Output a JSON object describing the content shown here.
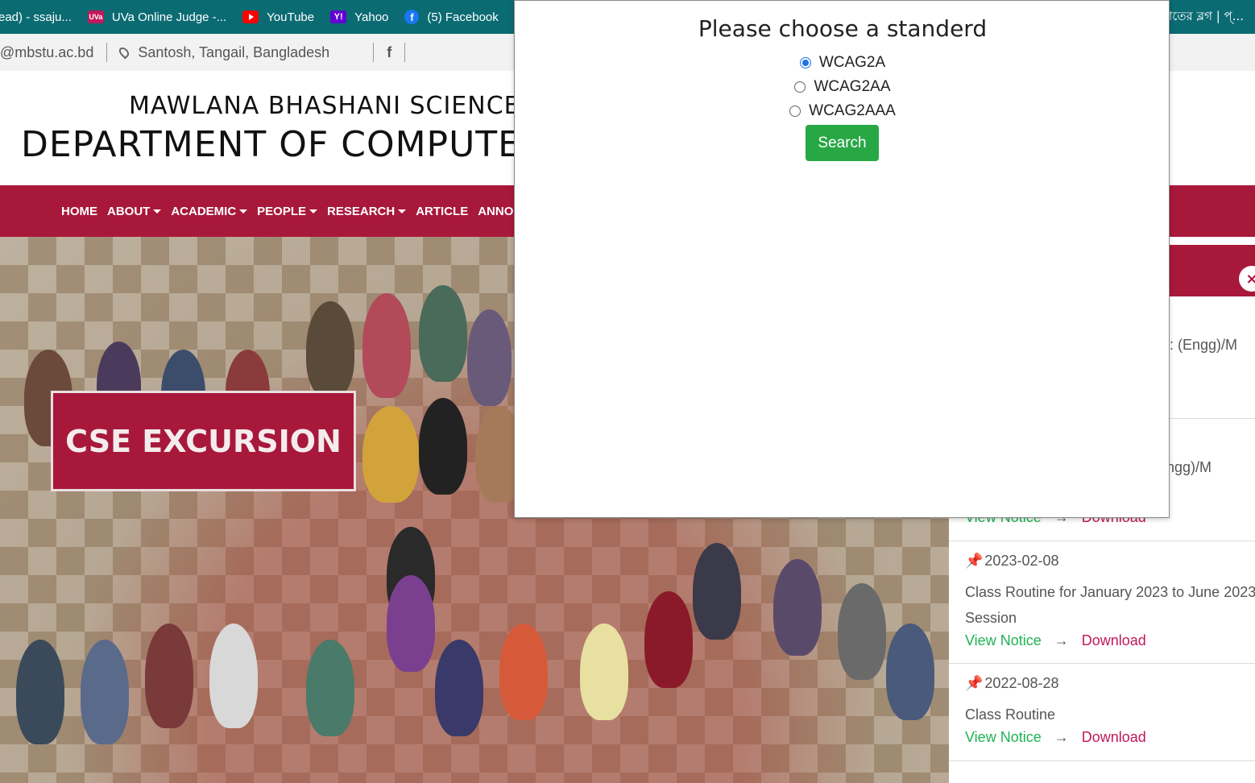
{
  "bookmarks": {
    "items": [
      {
        "label": "ead) - ssaju...",
        "icon": "page-icon"
      },
      {
        "label": "UVa Online Judge -...",
        "icon": "uva-icon"
      },
      {
        "label": "YouTube",
        "icon": "youtube-icon"
      },
      {
        "label": "Yahoo",
        "icon": "yahoo-icon"
      },
      {
        "label": "(5) Facebook",
        "icon": "facebook-icon"
      }
    ],
    "right_text": "াতের ব্লগ | প্..."
  },
  "contact": {
    "email": "@mbstu.ac.bd",
    "location": "Santosh, Tangail, Bangladesh"
  },
  "header": {
    "university": "MAWLANA BHASHANI SCIENCE AND",
    "department": "DEPARTMENT OF COMPUTER SC"
  },
  "nav": {
    "items": [
      "HOME",
      "ABOUT",
      "ACADEMIC",
      "PEOPLE",
      "RESEARCH",
      "ARTICLE",
      "ANNO"
    ]
  },
  "hero": {
    "caption": "CSE EXCURSION"
  },
  "notices": {
    "partial_1": ": (Engg)/M",
    "partial_2": "ngg)/M",
    "view_label": "View Notice",
    "download_label": "Download",
    "arrow": "→",
    "items": [
      {
        "date": "2023-02-08",
        "title": "Class Routine for January 2023 to June 2023",
        "title2": "Session"
      },
      {
        "date": "2022-08-28",
        "title": "Class Routine",
        "title2": ""
      }
    ]
  },
  "modal": {
    "title": "Please choose a standerd",
    "options": [
      "WCAG2A",
      "WCAG2AA",
      "WCAG2AAA"
    ],
    "selected": "WCAG2A",
    "button": "Search"
  },
  "colors": {
    "brand": "#a8183b",
    "bookmarks_bg": "#0b6b73",
    "view_link": "#1fb254",
    "download_link": "#c2185b",
    "search_button": "#28a745"
  }
}
